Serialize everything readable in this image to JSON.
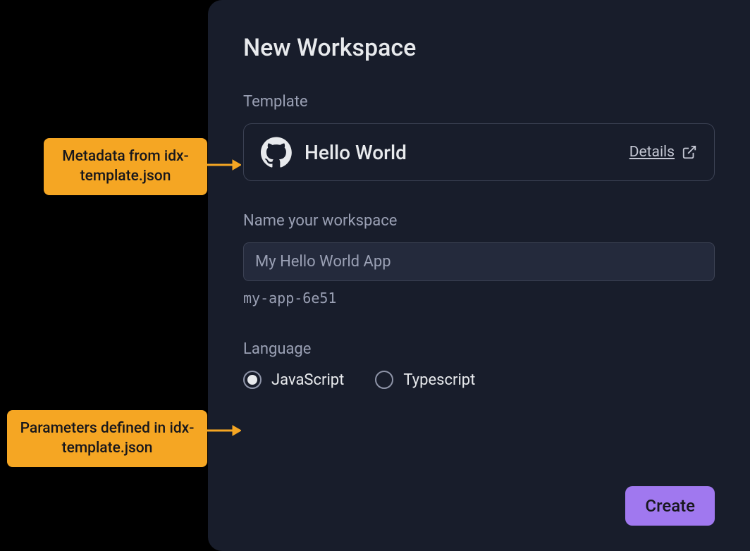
{
  "dialog": {
    "title": "New Workspace",
    "template_section_label": "Template",
    "template_name": "Hello World",
    "details_label": "Details",
    "name_section_label": "Name your workspace",
    "name_input_value": "My Hello World App",
    "workspace_slug": "my-app-6e51",
    "language_section_label": "Language",
    "language_options": [
      {
        "label": "JavaScript",
        "selected": true
      },
      {
        "label": "Typescript",
        "selected": false
      }
    ],
    "create_button_label": "Create"
  },
  "callouts": {
    "metadata": "Metadata from idx-template.json",
    "parameters": "Parameters defined in idx-template.json"
  },
  "colors": {
    "panel_bg": "#181d2b",
    "input_bg": "#242a3c",
    "border": "#3c4254",
    "text_primary": "#e8eaed",
    "text_muted": "#9aa0b4",
    "accent_button": "#a078ef",
    "callout_bg": "#f5a623"
  }
}
